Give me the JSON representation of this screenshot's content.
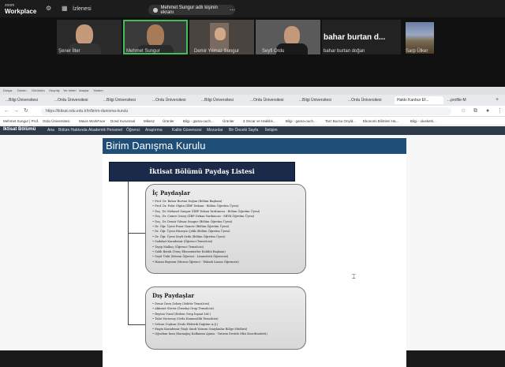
{
  "meeting": {
    "logo_small": "zoom",
    "logo_big": "Workplace",
    "gallery_label": "İzlenesi",
    "share_notice": "Mehmet Sungur adlı kişinin ekranı"
  },
  "participants": [
    {
      "name": "Şener İlter"
    },
    {
      "name": "Mehmet Sungur"
    },
    {
      "name": "Demir Yılmaz Sungur"
    },
    {
      "name": "Seyfi Ordu"
    },
    {
      "name": "bahar burtan doğan",
      "big_label": "bahar burtan d..."
    },
    {
      "name": "Sarp Ülker"
    }
  ],
  "browser": {
    "menu": [
      "Dosya",
      "Düzen",
      "Görünüm",
      "Geçmiş",
      "Yer imleri",
      "Araçlar",
      "Yardım"
    ],
    "tabs": [
      "...Bilgi Üniversitesi",
      "...Ordu Üniversitesi",
      "...Bilgi Üniversitesi",
      "...Ordu Üniversitesi",
      "...Bilgi Üniversitesi",
      "...Ordu Üniversitesi",
      "...Bilgi Üniversitesi",
      "...Ordu Üniversitesi",
      "Hakkı Kanbur Ef...",
      "...profile-M"
    ],
    "url": "https://iktisat.odu.edu.tr/tr/birim-danisma-kurulu",
    "bookmarks": [
      "Mehmet Sungur | Prof.",
      "Ordu Üniversitesi",
      "Mavis WorkFace",
      "Dosd",
      "Kurumsal",
      "Mikesz",
      "Ürünler",
      "Bilgi - gama-ouch...",
      "Ürünler",
      "3 Oscar ve Haklılık...",
      "Bilgi - gama-ouch...",
      "Tarz Buzsu Onyld...",
      "Ekonomi Bilimleri Ha...",
      "Bilgi - ulusketlı..."
    ],
    "site_brand": "İktisat Bölümü",
    "site_nav": [
      "Ana",
      "Bölüm Hakkında",
      "Akademik Personel",
      "Öğrenci",
      "Araştırma",
      "Kalite Güvencesi",
      "Mezunlar",
      "Bir Önceki Sayfa",
      "İletişim"
    ]
  },
  "slide": {
    "title": "Birim Danışma Kurulu",
    "list_title": "İktisat Bölümü Paydaş Listesi",
    "internal": {
      "heading": "İç Paydaşlar",
      "items": [
        "Prof. Dr. Bahar Burtan Doğan (Bölüm Başkanı)",
        "Prof. Dr. Polat Olgün (İİBF Dekanı - Bölüm Öğretim Üyesi)",
        "Doç. Dr. Mehmet Sungur (İİBF Dekan Yardımcısı - Bölüm Öğretim Üyesi)",
        "Doç. Dr. Cemre Ozsoy (İİBF Dekan Yardımcısı - SBYK Öğretim Üyesi)",
        "Doç. Dr. Demir Yılmaz Sungur (Bölüm Öğretim Üyesi)",
        "Dr. Öğr. Üyesi Pınar Gancer (Bölüm Öğretim Üyesi)",
        "Dr. Öğr. Üyesi Hüseyin Çelik (Bölüm Öğretim Üyesi)",
        "Dr. Öğr. Üyesi Seyfi Ordu (Bölüm Öğretim Üyesi)",
        "Sadakat Karademir (Öğrenci Temsilcisi)",
        "Tayip Malkoç (Öğrenci Temsilcisi)",
        "Salih Batuk (Genç Ekonomistler Kulübü Başkanı)",
        "Seyit Ünlü (Mezun Öğrenci - Lisansüstü Öğrencisi)",
        "Hasan Bayram (Mezun Öğrenci - Yüksek Lisans Öğrencisi)"
      ]
    },
    "external": {
      "heading": "Dış Paydaşlar",
      "items": [
        "Deniz Özen Zelzey (Sektör Temsilcisi)",
        "Akhmet Güven (Örnekçi Grup Temsilcisi)",
        "Beytan Vural (Erdem Grup İnşaat Ltd.)",
        "Talat Yavuzsoy (Ordu Kamusallık Temsilcisi)",
        "Selcan Coşkun (Dodo Elektrik Dağıtım A.Ş.)",
        "Engin Karademir (Yaşlı Sınıfı Yatırım Onaylanlar Bölge Müdürü)",
        "Oğuzhan İnan (Karaağaç Kalkınma Ajansı - Yatırım Destek Ofisi Koordinatörü)"
      ]
    }
  }
}
